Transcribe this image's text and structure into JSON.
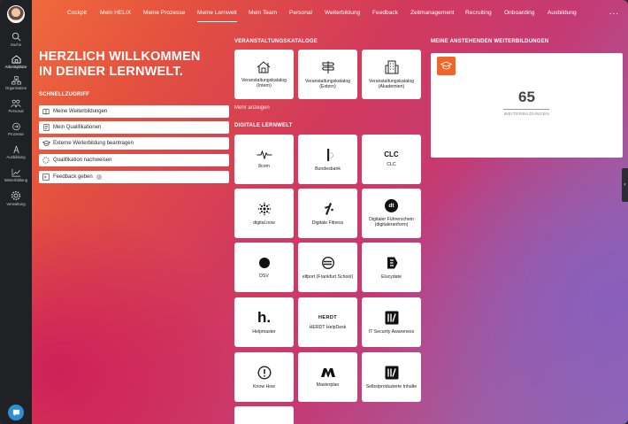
{
  "sidebar": {
    "items": [
      {
        "label": "Suche",
        "icon": "search-icon"
      },
      {
        "label": "Arbeitsplätze",
        "icon": "home-icon"
      },
      {
        "label": "Organisation",
        "icon": "org-icon"
      },
      {
        "label": "Personal",
        "icon": "people-icon"
      },
      {
        "label": "Prozesse",
        "icon": "process-icon"
      },
      {
        "label": "Ausbildung",
        "icon": "training-icon"
      },
      {
        "label": "Weiterbildung",
        "icon": "chart-icon"
      },
      {
        "label": "Verwaltung",
        "icon": "gear-icon"
      }
    ]
  },
  "nav": {
    "tabs": [
      "Cockpit",
      "Mein HELIX",
      "Meine Prozesse",
      "Meine Lernwelt",
      "Mein Team",
      "Personal",
      "Weiterbildung",
      "Feedback",
      "Zeitmanagement",
      "Recruiting",
      "Onboarding",
      "Ausbildung"
    ],
    "active": "Meine Lernwelt",
    "more": "..."
  },
  "welcome": {
    "line1": "HERZLICH WILLKOMMEN",
    "line2": "IN DEINER LERNWELT."
  },
  "schnellzugriff": {
    "title": "SCHNELLZUGRIFF",
    "items": [
      {
        "label": "Meine Weiterbildungen",
        "icon": "book-icon"
      },
      {
        "label": "Mein Qualifikationen",
        "icon": "document-icon"
      },
      {
        "label": "Externe Weiterbildung beantragen",
        "icon": "graduation-icon"
      },
      {
        "label": "Qualifikation nachweisen",
        "icon": "dashed-circle-icon"
      },
      {
        "label": "Feedback geben",
        "icon": "feedback-icon",
        "info": "i"
      }
    ]
  },
  "kataloge": {
    "title": "VERANSTALTUNGSKATALOGE",
    "items": [
      {
        "label": "Veranstaltungskatalog (Intern)",
        "icon": "house-icon"
      },
      {
        "label": "Veranstaltungskatalog (Extern)",
        "icon": "signpost-icon"
      },
      {
        "label": "Veranstaltungskatalog (Akademien)",
        "icon": "building-icon"
      }
    ],
    "more": "Mehr anzeigen"
  },
  "lernwelt": {
    "title": "DIGITALE LERNWELT",
    "items": [
      {
        "label": "8com",
        "icon": "pulse-icon"
      },
      {
        "label": "Bundesbank",
        "icon": "bar-circle-icon"
      },
      {
        "label": "CLC",
        "icon": "clc-logo-icon",
        "logo": "CLC"
      },
      {
        "label": "digital.now",
        "icon": "dots-sphere-icon"
      },
      {
        "label": "Digitale Fitness",
        "icon": "runner-icon"
      },
      {
        "label": "Digitaler Führerschein (digitaleranform)",
        "icon": "dt-logo-icon",
        "logo": "dt"
      },
      {
        "label": "DSV",
        "icon": "filled-circle-icon"
      },
      {
        "label": "elfport (Frankfurt School)",
        "icon": "euro-icon"
      },
      {
        "label": "Elucydate",
        "icon": "e-logo-icon"
      },
      {
        "label": "Helpmaster",
        "icon": "h-logo-icon",
        "logo": "h."
      },
      {
        "label": "HERDT HelpDesk",
        "icon": "herdt-logo-icon",
        "logo": "HERDT"
      },
      {
        "label": "IT Security Awareness",
        "icon": "slash-box-icon"
      },
      {
        "label": "Know How",
        "icon": "exclamation-icon"
      },
      {
        "label": "Masterplan",
        "icon": "m-logo-icon"
      },
      {
        "label": "Selbstproduzierte Inhalte",
        "icon": "slash-box-icon"
      }
    ]
  },
  "pending": {
    "title": "MEINE ANSTEHENDEN WEITERBILDUNGEN",
    "count": "65",
    "label": "WEITERBILDUNGEN"
  }
}
